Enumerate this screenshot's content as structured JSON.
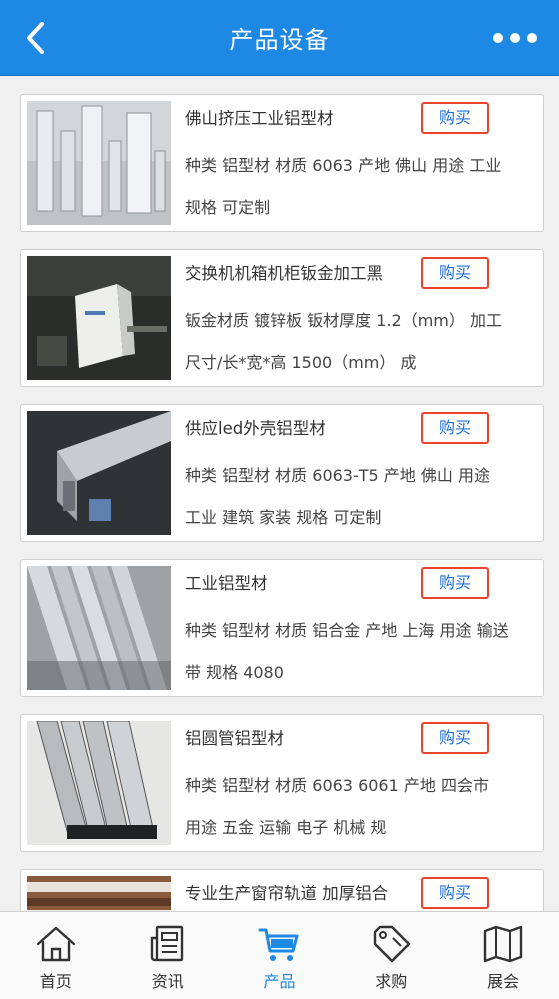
{
  "header": {
    "title": "产品设备"
  },
  "products": [
    {
      "name": "佛山挤压工业铝型材",
      "buy_label": "购买",
      "description": "种类 铝型材 材质 6063 产地 佛山 用途 工业 规格 可定制"
    },
    {
      "name": "交换机机箱机柜钣金加工黑",
      "buy_label": "购买",
      "description": "钣金材质 镀锌板 钣材厚度 1.2（mm） 加工尺寸/长*宽*高 1500（mm） 成"
    },
    {
      "name": "供应led外壳铝型材",
      "buy_label": "购买",
      "description": "种类 铝型材 材质 6063-T5 产地 佛山 用途 工业 建筑 家装 规格 可定制"
    },
    {
      "name": "工业铝型材",
      "buy_label": "购买",
      "description": "种类 铝型材 材质 铝合金 产地 上海 用途 输送带 规格 4080"
    },
    {
      "name": "铝圆管铝型材",
      "buy_label": "购买",
      "description": "种类 铝型材 材质 6063 6061 产地 四会市 用途 五金 运输 电子 机械 规"
    },
    {
      "name": "专业生产窗帘轨道 加厚铝合",
      "buy_label": "购买",
      "description": ""
    }
  ],
  "tabbar": {
    "tabs": [
      {
        "label": "首页",
        "icon": "home-icon"
      },
      {
        "label": "资讯",
        "icon": "news-icon"
      },
      {
        "label": "产品",
        "icon": "cart-icon",
        "active": true
      },
      {
        "label": "求购",
        "icon": "tag-icon"
      },
      {
        "label": "展会",
        "icon": "map-icon"
      }
    ]
  },
  "colors": {
    "primary": "#1e88e5",
    "buy_border": "#e8452c",
    "buy_text": "#1e6fd9"
  }
}
